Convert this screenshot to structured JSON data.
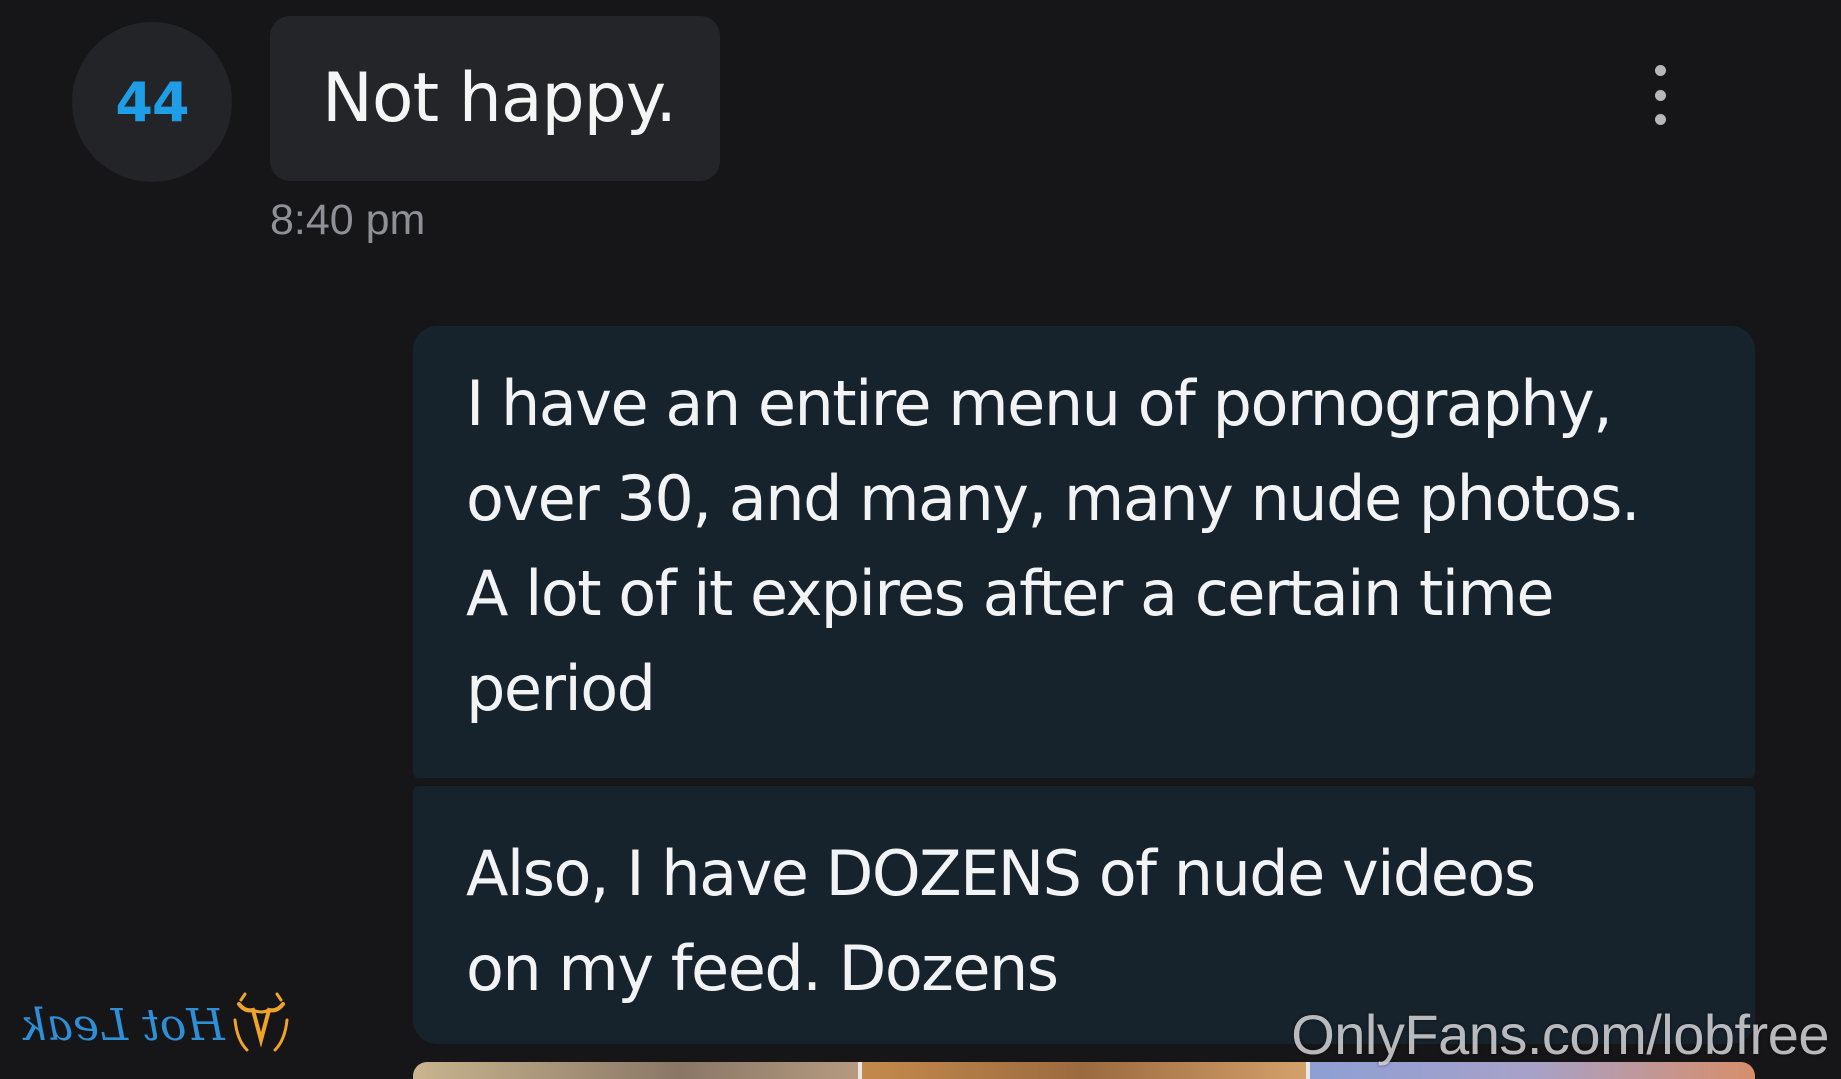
{
  "avatar": {
    "label": "44",
    "color": "#1e9ee6"
  },
  "incoming_message": {
    "text": "Not happy.",
    "time": "8:40 pm"
  },
  "menu": {
    "icon": "more-vertical-icon"
  },
  "outgoing_messages": [
    {
      "text": "I have an entire menu of pornography,\nover 30, and many, many nude photos.\nA lot of it expires after a certain time\nperiod"
    },
    {
      "text": "Also, I have DOZENS of nude videos\non my feed. Dozens"
    }
  ],
  "watermarks": {
    "left_text": "Hot Leak",
    "left_logo": "hotleak-logo-icon",
    "right_text": "OnlyFans.com/lobfree"
  },
  "colors": {
    "background": "#161618",
    "incoming_bubble": "#242528",
    "outgoing_bubble": "#16232c",
    "accent": "#1e9ee6"
  }
}
